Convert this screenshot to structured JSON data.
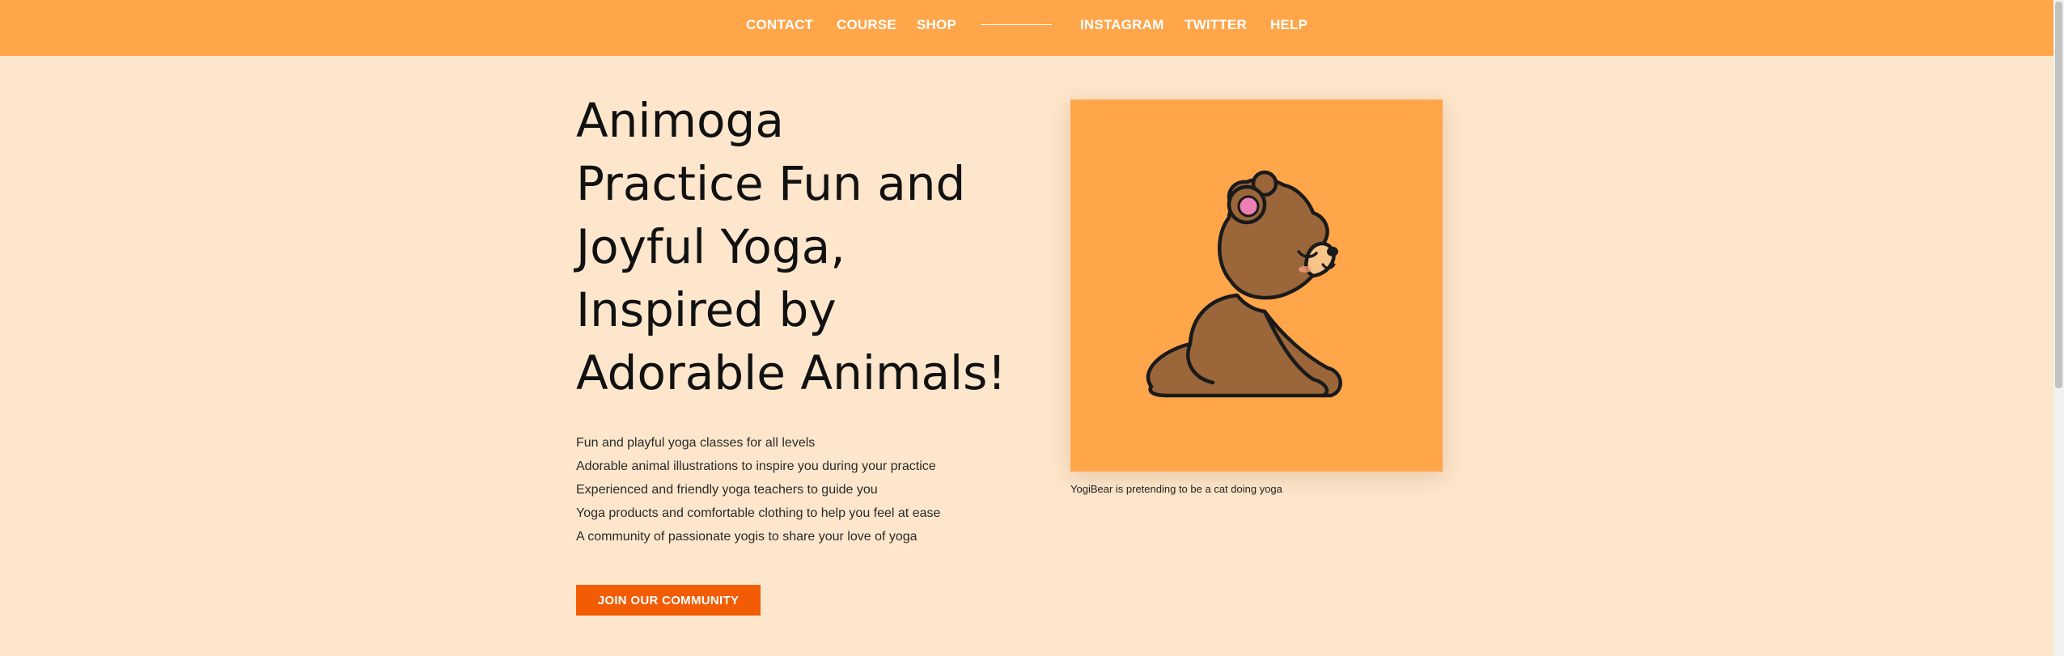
{
  "nav": {
    "left_links": [
      "CONTACT",
      "COURSE",
      "SHOP"
    ],
    "right_links": [
      "INSTAGRAM",
      "TWITTER",
      "HELP"
    ]
  },
  "hero": {
    "title_lines": [
      "Animoga",
      "Practice Fun and",
      "Joyful Yoga,",
      "Inspired by",
      "Adorable Animals!"
    ],
    "features": [
      "Fun and playful yoga classes for all levels",
      "Adorable animal illustrations to inspire you during your practice",
      "Experienced and friendly yoga teachers to guide you",
      "Yoga products and comfortable clothing to help you feel at ease",
      "A community of passionate yogis to share your love of yoga"
    ],
    "cta_label": "JOIN OUR COMMUNITY"
  },
  "image": {
    "alt": "bear-doing-yoga-illustration",
    "caption": "YogiBear is pretending to be a cat doing yoga"
  },
  "colors": {
    "nav_bg": "#ffa64b",
    "page_bg": "#fde6cb",
    "cta_bg": "#f25c05",
    "image_bg": "#ffa64b",
    "bear_fur": "#9a663a",
    "bear_muzzle": "#f6c489",
    "bear_ear_inner": "#ee7fb3"
  }
}
